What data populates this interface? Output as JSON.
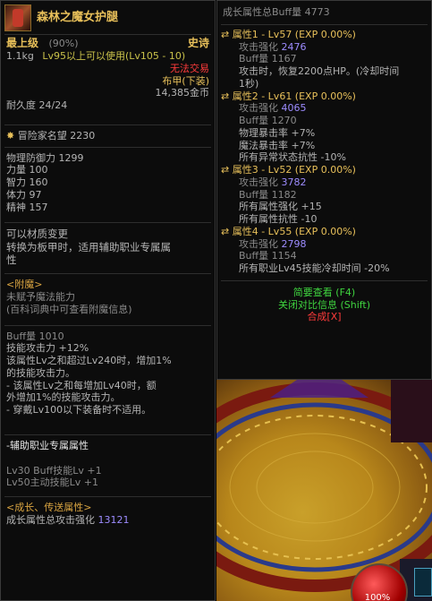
{
  "item": {
    "name": "森林之魔女护腿",
    "grade": "最上级",
    "grade_pct": "(90%)",
    "rarity": "史诗",
    "weight": "1.1kg",
    "level_req": "Lv95以上可以使用(Lv105 - 10)",
    "trade": "无法交易",
    "armor_type": "布甲(下装)",
    "price": "14,385金币",
    "durability": "耐久度 24/24",
    "reputation": "冒险家名望 2230",
    "stats": [
      "物理防御力 1299",
      "力量 100",
      "智力 160",
      "体力 97",
      "精神 157"
    ],
    "transfer": [
      "可以材质变更",
      "转换为板甲时，适用辅助职业专属属",
      "性"
    ],
    "enchant": {
      "title": "<附魔>",
      "line1": "未赋予魔法能力",
      "line2": "(百科词典中可查看附魔信息)"
    },
    "buff_block": {
      "buff": "Buff量 1010",
      "lines": [
        "技能攻击力 +12%",
        "该属性Lv之和超过Lv240时，增加1%",
        "的技能攻击力。",
        "- 该属性Lv之和每增加Lv40时，额",
        "外增加1%的技能攻击力。",
        "- 穿戴Lv100以下装备时不适用。"
      ]
    },
    "support": {
      "title": "-辅助职业专属属性",
      "lines": [
        "Lv30 Buff技能Lv +1",
        "Lv50主动技能Lv +1"
      ]
    },
    "growth": {
      "title": "<成长、传送属性>",
      "attack_label": "成长属性总攻击强化",
      "attack_value": "13121"
    }
  },
  "right": {
    "total_buff_label": "成长属性总Buff量",
    "total_buff_value": "4773",
    "props": [
      {
        "title": "属性1 - Lv57 (EXP 0.00%)",
        "atk_label": "攻击强化",
        "atk": "2476",
        "buff": "Buff量 1167",
        "desc": [
          "攻击时，恢复2200点HP。(冷却时间",
          "1秒)"
        ]
      },
      {
        "title": "属性2 - Lv61 (EXP 0.00%)",
        "atk_label": "攻击强化",
        "atk": "4065",
        "buff": "Buff量 1270",
        "desc": [
          "物理暴击率 +7%",
          "魔法暴击率 +7%",
          "所有异常状态抗性 -10%"
        ]
      },
      {
        "title": "属性3 - Lv52 (EXP 0.00%)",
        "atk_label": "攻击强化",
        "atk": "3782",
        "buff": "Buff量 1182",
        "desc": [
          "所有属性强化 +15",
          "所有属性抗性 -10"
        ]
      },
      {
        "title": "属性4 - Lv55 (EXP 0.00%)",
        "atk_label": "攻击强化",
        "atk": "2798",
        "buff": "Buff量 1154",
        "desc": [
          "所有职业Lv45技能冷却时间 -20%"
        ]
      }
    ],
    "brief": "简要查看 (F4)",
    "close_compare": "关闭对比信息 (Shift)",
    "synth": "合成[X]"
  },
  "game": {
    "hp_pct": "100%"
  }
}
